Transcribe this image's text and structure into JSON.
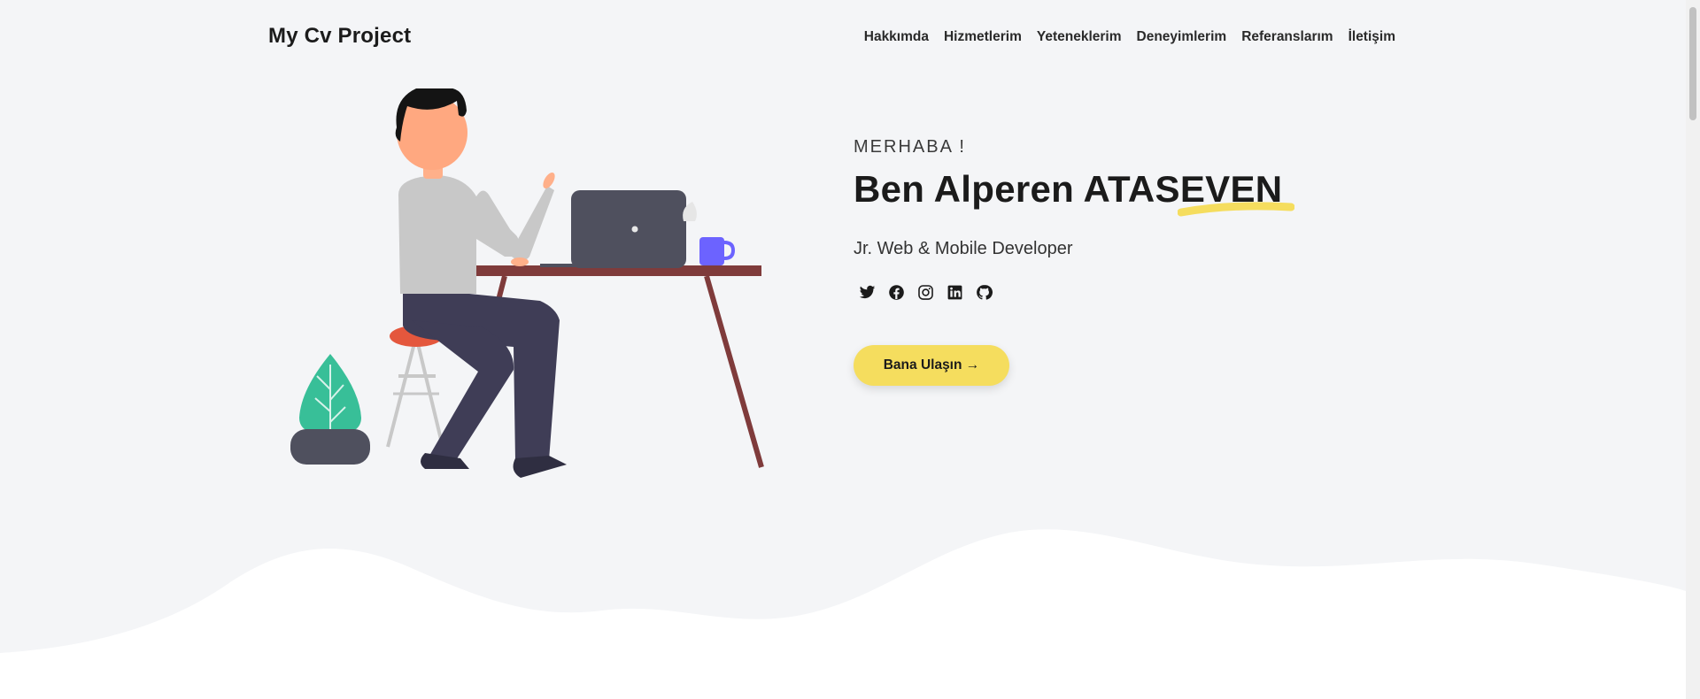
{
  "header": {
    "brand": "My Cv Project",
    "nav": [
      "Hakkımda",
      "Hizmetlerim",
      "Yeteneklerim",
      "Deneyimlerim",
      "Referanslarım",
      "İletişim"
    ]
  },
  "hero": {
    "greeting": "MERHABA !",
    "name": "Ben Alperen ATASEVEN",
    "role": "Jr. Web & Mobile Developer",
    "cta_label": "Bana Ulaşın →",
    "socials": [
      "twitter-icon",
      "facebook-icon",
      "instagram-icon",
      "linkedin-icon",
      "github-icon"
    ]
  },
  "colors": {
    "background": "#f4f5f7",
    "accent": "#f5dd5e",
    "text": "#1b1b1b",
    "plant": "#38bf98",
    "mug": "#6c63ff",
    "desk": "#7f3b3b",
    "laptop": "#4f505e"
  }
}
